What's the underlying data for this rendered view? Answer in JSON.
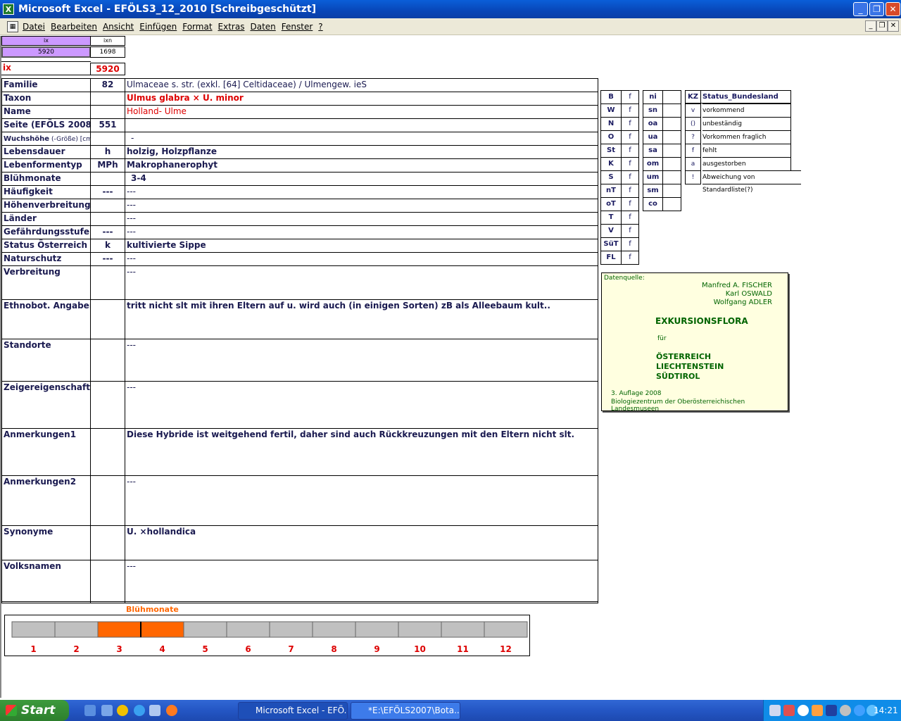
{
  "window": {
    "title": "Microsoft Excel - EFÖLS3_12_2010  [Schreibgeschützt]"
  },
  "menu": [
    "Datei",
    "Bearbeiten",
    "Ansicht",
    "Einfügen",
    "Format",
    "Extras",
    "Daten",
    "Fenster",
    "?"
  ],
  "index_box": {
    "h1": "ix",
    "h2": "ixn",
    "v1": "5920",
    "v2": "1698",
    "ix_label": "ix",
    "ix_value": "5920"
  },
  "rows": [
    {
      "label": "Familie",
      "code": "82",
      "value": "Ulmaceae s. str. (exkl. [64] Celtidaceae)  /  Ulmengew. ieS"
    },
    {
      "label": "Taxon",
      "code": "",
      "value": "Ulmus glabra × U. minor"
    },
    {
      "label": "Name",
      "code": "",
      "value": "Holland- Ulme"
    },
    {
      "label": "Seite (EFÖLS 2008)",
      "code": "551",
      "value": ""
    },
    {
      "label": "Wuchshöhe",
      "label_suffix": "(-Größe) [cm]",
      "code": "",
      "value": "-"
    },
    {
      "label": "Lebensdauer",
      "code": "h",
      "value": "holzig, Holzpflanze"
    },
    {
      "label": "Lebenformentyp",
      "code": "MPh",
      "value": "Makrophanerophyt"
    },
    {
      "label": "Blühmonate",
      "code": "",
      "value": "3-4"
    },
    {
      "label": "Häufigkeit",
      "code": "---",
      "value": "---"
    },
    {
      "label": "Höhenverbreitung",
      "code": "",
      "value": "---"
    },
    {
      "label": "Länder",
      "code": "",
      "value": "---"
    },
    {
      "label": "Gefährdungsstufe",
      "code": "---",
      "value": "---"
    },
    {
      "label": "Status Österreich",
      "code": "k",
      "value": "kultivierte Sippe"
    },
    {
      "label": "Naturschutz",
      "code": "---",
      "value": "---"
    },
    {
      "label": "Verbreitung",
      "code": "",
      "value": "---"
    },
    {
      "label": "Ethnobot. Angaben",
      "code": "",
      "value": "tritt nicht slt mit ihren Eltern auf u. wird auch (in einigen Sorten) zB als Alleebaum kult.."
    },
    {
      "label": "Standorte",
      "code": "",
      "value": "---"
    },
    {
      "label": "Zeigereigenschaften",
      "code": "",
      "value": "---"
    },
    {
      "label": "Anmerkungen1",
      "code": "",
      "value": "Diese Hybride ist weitgehend fertil, daher sind auch Rückkreuzungen mit den Eltern nicht slt."
    },
    {
      "label": "Anmerkungen2",
      "code": "",
      "value": "---"
    },
    {
      "label": "Synonyme",
      "code": "",
      "value": "U. ×hollandica"
    },
    {
      "label": "Volksnamen",
      "code": "",
      "value": "---"
    }
  ],
  "regions": [
    "B",
    "W",
    "N",
    "O",
    "St",
    "K",
    "S",
    "nT",
    "oT",
    "T",
    "V",
    "SüT",
    "FL"
  ],
  "regions_f": "f",
  "altitudes": [
    "ni",
    "sn",
    "oa",
    "ua",
    "sa",
    "om",
    "um",
    "sm",
    "co"
  ],
  "status_header": {
    "kz": "KZ",
    "title": "Status_Bundesland"
  },
  "status": [
    {
      "code": "v",
      "text": "vorkommend"
    },
    {
      "code": "()",
      "text": "unbeständig"
    },
    {
      "code": "?",
      "text": "Vorkommen fraglich"
    },
    {
      "code": "f",
      "text": "fehlt"
    },
    {
      "code": "a",
      "text": "ausgestorben"
    },
    {
      "code": "!",
      "text": "Abweichung von Standardliste(?)"
    }
  ],
  "source": {
    "label": "Datenquelle:",
    "authors": [
      "Manfred A. FISCHER",
      "Karl OSWALD",
      "Wolfgang ADLER"
    ],
    "title": "EXKURSIONSFLORA",
    "fuer": "für",
    "countries": [
      "ÖSTERREICH",
      "LIECHTENSTEIN",
      "SÜDTIROL"
    ],
    "edition": "3. Auflage 2008",
    "publisher": "Biologiezentrum der Oberösterreichischen Landesmuseen"
  },
  "chart_data": {
    "type": "bar",
    "title": "Blühmonate",
    "categories": [
      "1",
      "2",
      "3",
      "4",
      "5",
      "6",
      "7",
      "8",
      "9",
      "10",
      "11",
      "12"
    ],
    "values": [
      0,
      0,
      1,
      1,
      0,
      0,
      0,
      0,
      0,
      0,
      0,
      0
    ],
    "colors": {
      "active": "#ff6600",
      "inactive": "#c0c0c0"
    }
  },
  "taskbar": {
    "start": "Start",
    "items": [
      "Microsoft Excel - EFÖ...",
      "*E:\\EFÖLS2007\\Bota..."
    ],
    "clock": "14:21"
  }
}
